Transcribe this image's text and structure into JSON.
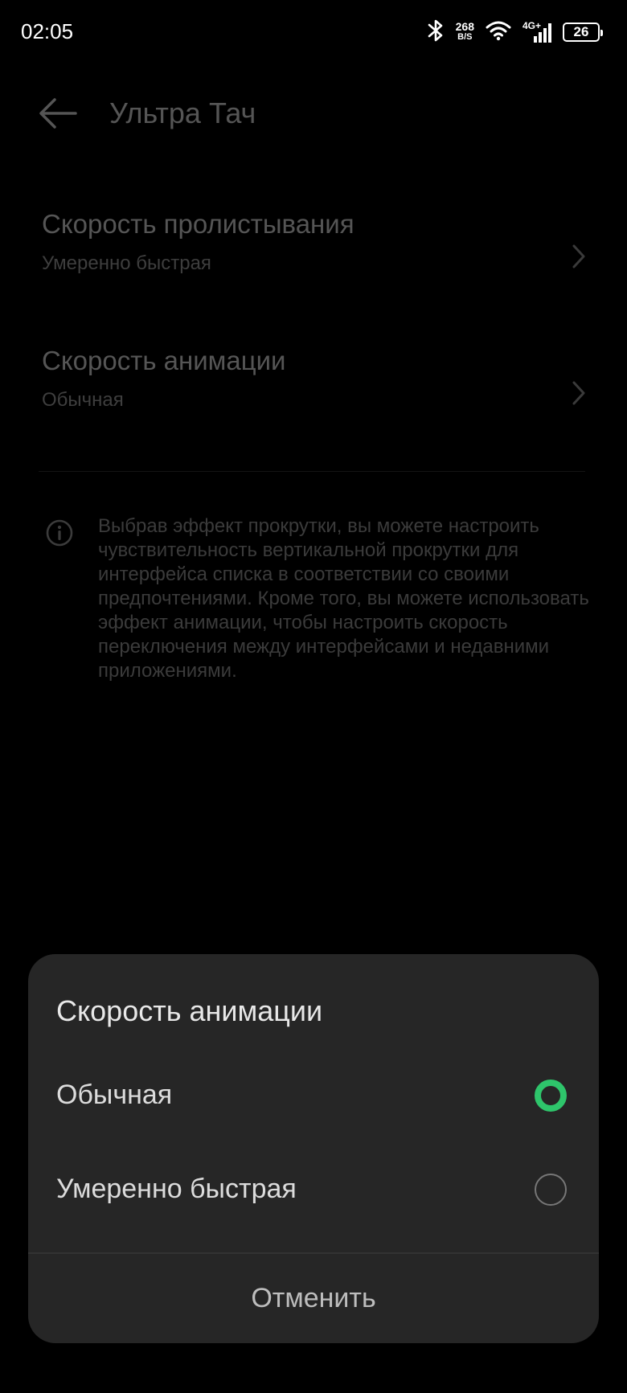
{
  "status_bar": {
    "time": "02:05",
    "net_speed_value": "268",
    "net_speed_unit": "B/S",
    "network_label": "4G+",
    "battery_level": "26",
    "icons": [
      "bluetooth-icon",
      "wifi-icon",
      "cellular-signal-icon",
      "battery-icon"
    ]
  },
  "header": {
    "title": "Ультра Тач",
    "back_icon": "arrow-left-icon"
  },
  "settings": [
    {
      "title": "Скорость пролистывания",
      "value": "Умеренно быстрая"
    },
    {
      "title": "Скорость анимации",
      "value": "Обычная"
    }
  ],
  "info": {
    "icon": "info-icon",
    "text": "Выбрав эффект прокрутки, вы можете настроить чувствительность вертикальной прокрутки для интерфейса списка в соответствии со своими предпочтениями. Кроме того, вы можете использовать эффект анимации, чтобы настроить скорость переключения между интерфейсами и недавними приложениями."
  },
  "sheet": {
    "title": "Скорость анимации",
    "options": [
      {
        "label": "Обычная",
        "selected": true
      },
      {
        "label": "Умеренно быстрая",
        "selected": false
      }
    ],
    "cancel_label": "Отменить"
  },
  "colors": {
    "accent": "#2ec56b",
    "sheet_background": "#262626",
    "background": "#000000"
  }
}
